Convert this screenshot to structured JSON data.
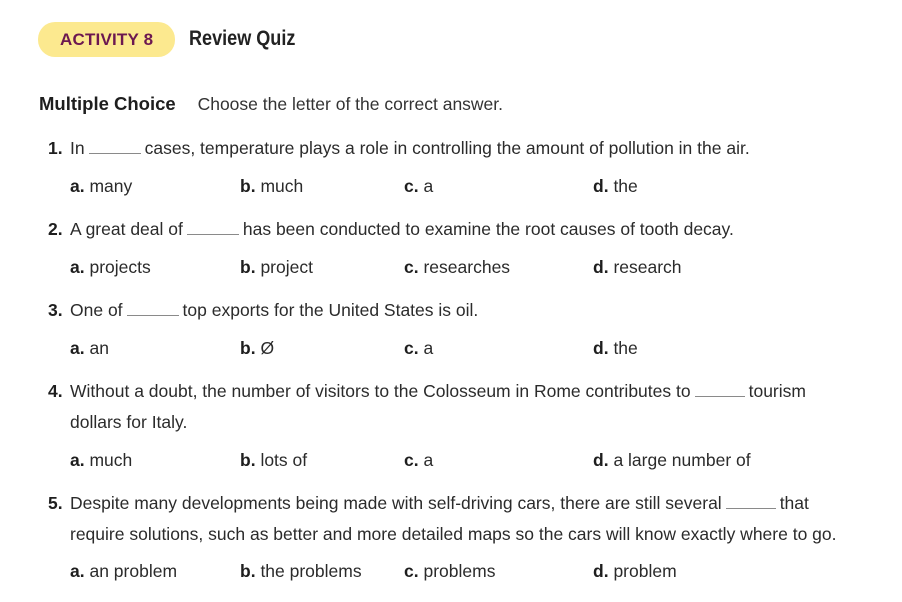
{
  "header": {
    "badge": "ACTIVITY 8",
    "title": "Review Quiz"
  },
  "instructions": {
    "label": "Multiple Choice",
    "text": "Choose the letter of the correct answer."
  },
  "questions": [
    {
      "number": "1.",
      "before": "In",
      "after": "cases, temperature plays a role in controlling the amount of pollution in the air.",
      "continuation": "",
      "options": [
        {
          "letter": "a.",
          "text": "many"
        },
        {
          "letter": "b.",
          "text": "much"
        },
        {
          "letter": "c.",
          "text": "a"
        },
        {
          "letter": "d.",
          "text": "the"
        }
      ]
    },
    {
      "number": "2.",
      "before": "A great deal of",
      "after": "has been conducted to examine the root causes of tooth decay.",
      "continuation": "",
      "options": [
        {
          "letter": "a.",
          "text": "projects"
        },
        {
          "letter": "b.",
          "text": "project"
        },
        {
          "letter": "c.",
          "text": "researches"
        },
        {
          "letter": "d.",
          "text": "research"
        }
      ]
    },
    {
      "number": "3.",
      "before": "One of",
      "after": "top exports for the United States is oil.",
      "continuation": "",
      "options": [
        {
          "letter": "a.",
          "text": "an"
        },
        {
          "letter": "b.",
          "text": "Ø"
        },
        {
          "letter": "c.",
          "text": "a"
        },
        {
          "letter": "d.",
          "text": "the"
        }
      ]
    },
    {
      "number": "4.",
      "before": "Without a doubt, the number of visitors to the Colosseum in Rome contributes to",
      "after": "tourism",
      "continuation": "dollars for Italy.",
      "options": [
        {
          "letter": "a.",
          "text": "much"
        },
        {
          "letter": "b.",
          "text": "lots of"
        },
        {
          "letter": "c.",
          "text": "a"
        },
        {
          "letter": "d.",
          "text": "a large number of"
        }
      ]
    },
    {
      "number": "5.",
      "before": "Despite many developments being made with self-driving cars, there are still several",
      "after": "that",
      "continuation": "require solutions, such as better and more detailed maps so the cars will know exactly where to go.",
      "options": [
        {
          "letter": "a.",
          "text": "an problem"
        },
        {
          "letter": "b.",
          "text": "the problems"
        },
        {
          "letter": "c.",
          "text": "problems"
        },
        {
          "letter": "d.",
          "text": "problem"
        }
      ]
    }
  ]
}
